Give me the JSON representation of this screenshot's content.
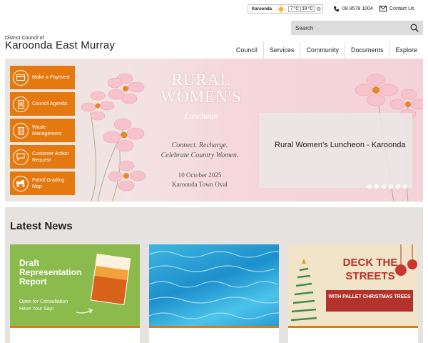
{
  "topbar": {
    "weather_location": "Karoonda",
    "weather_temps": "7 °C | 19 °C",
    "phone": "08 8578 1004",
    "contact_label": "Contact Us"
  },
  "search": {
    "placeholder": "Search"
  },
  "logo": {
    "small": "District Council of",
    "big": "Karoonda East Murray"
  },
  "nav": [
    "Council",
    "Services",
    "Community",
    "Documents",
    "Explore"
  ],
  "quick_links": [
    {
      "label": "Make a Payment",
      "icon": "card-icon"
    },
    {
      "label": "Council Agenda",
      "icon": "document-icon"
    },
    {
      "label": "Waste Management",
      "icon": "bin-icon"
    },
    {
      "label": "Customer Action Request",
      "icon": "chat-icon"
    },
    {
      "label": "Patrol Grading Map",
      "icon": "grader-icon"
    }
  ],
  "hero": {
    "title": "RURAL WOMEN'S",
    "script": "Luncheon",
    "tagline1": "Connect. Recharge.",
    "tagline2": "Celebrate Country Women.",
    "date": "10 October 2025",
    "venue": "Karoonda Town Oval",
    "caption": "Rural Women's Luncheon - Karoonda",
    "slide_count": 6,
    "active_slide": 2
  },
  "news": {
    "heading": "Latest News",
    "cards": [
      {
        "title": "Draft Representation Report",
        "subtitle": "Open for Consultation Have Your Say!"
      },
      {
        "title": ""
      },
      {
        "title": "DECK THE STREETS",
        "banner": "WITH PALLET CHRISTMAS TREES"
      }
    ]
  },
  "colors": {
    "accent": "#e47910",
    "news_bg": "#e5e2df",
    "search_bg": "#dcdcdc"
  }
}
